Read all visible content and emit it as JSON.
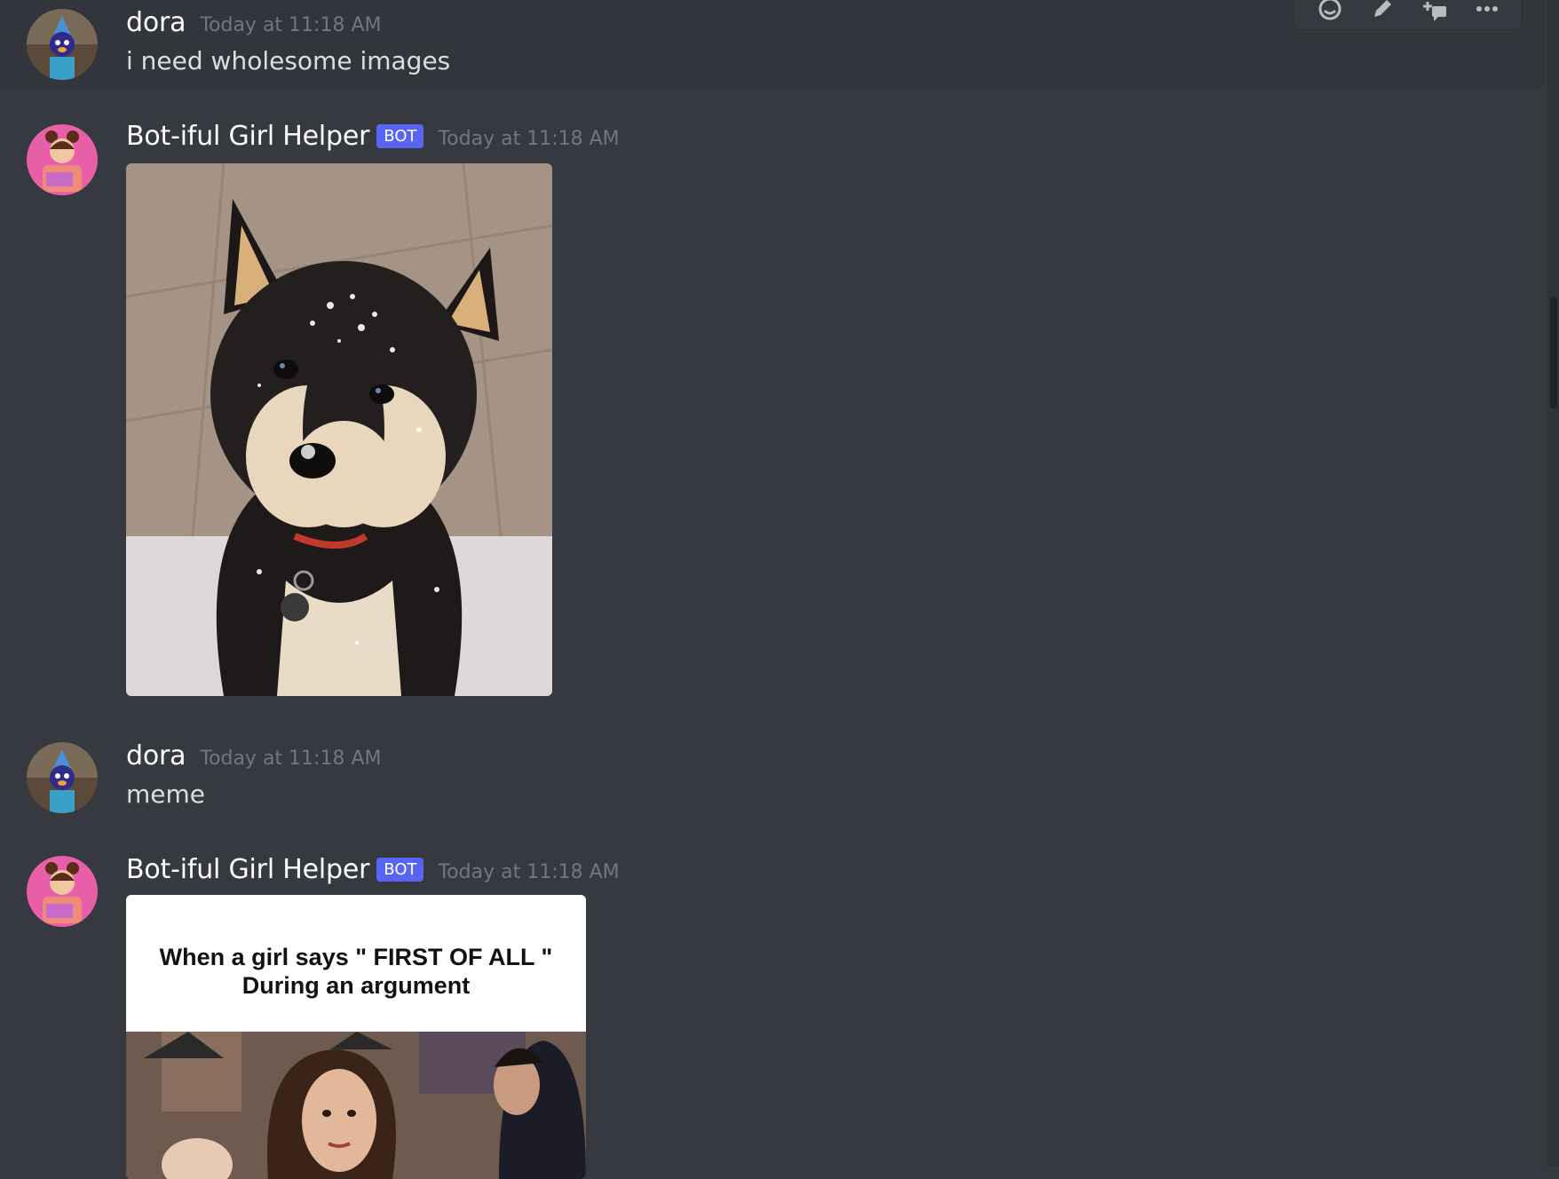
{
  "messages": [
    {
      "author": "dora",
      "timestamp": "Today at 11:18 AM",
      "text": "i need wholesome images"
    },
    {
      "author": "Bot-iful Girl Helper",
      "bot_tag": "BOT",
      "timestamp": "Today at 11:18 AM",
      "attachment": "shiba-puppy-in-snow-photo"
    },
    {
      "author": "dora",
      "timestamp": "Today at 11:18 AM",
      "text": "meme"
    },
    {
      "author": "Bot-iful Girl Helper",
      "bot_tag": "BOT",
      "timestamp": "Today at 11:18 AM",
      "meme": {
        "line1": "When a girl says \" FIRST OF ALL \"",
        "line2": "During an argument"
      }
    }
  ],
  "toolbar": {
    "icons": [
      "add-reaction-icon",
      "edit-icon",
      "create-thread-icon",
      "more-icon"
    ]
  },
  "colors": {
    "background": "#36393f",
    "bot_tag": "#5865f2",
    "timestamp": "#72767d",
    "text": "#dcddde"
  }
}
